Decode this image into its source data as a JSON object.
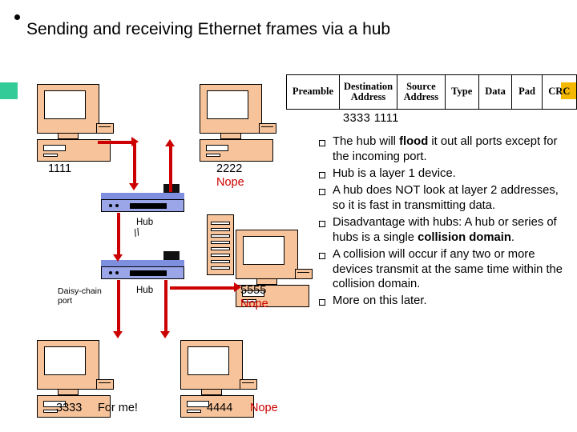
{
  "slide": {
    "title": "Sending and receiving Ethernet frames via a hub",
    "accent_green": "#33cc99",
    "accent_yellow": "#f5b800",
    "arrow_color": "#cc0000"
  },
  "frame_table": {
    "headers": [
      "Preamble",
      "Destination Address",
      "Source Address",
      "Type",
      "Data",
      "Pad",
      "CRC"
    ],
    "caption": "3333   1111"
  },
  "bullets": [
    {
      "parts": [
        {
          "text": "The hub will ",
          "bold": false
        },
        {
          "text": "flood",
          "bold": true
        },
        {
          "text": " it out all ports except for the incoming port.",
          "bold": false
        }
      ]
    },
    {
      "parts": [
        {
          "text": "Hub is a layer 1 device.",
          "bold": false
        }
      ]
    },
    {
      "parts": [
        {
          "text": "A hub does NOT look at layer 2 addresses, so it is fast in transmitting data.",
          "bold": false
        }
      ]
    },
    {
      "parts": [
        {
          "text": "Disadvantage with hubs:  A hub or series of hubs is a single ",
          "bold": false
        },
        {
          "text": "collision domain",
          "bold": true
        },
        {
          "text": ".",
          "bold": false
        }
      ]
    },
    {
      "parts": [
        {
          "text": "A collision will occur if any two or more devices transmit at the same time within the collision domain.",
          "bold": false
        }
      ]
    },
    {
      "parts": [
        {
          "text": "More on this later.",
          "bold": false
        }
      ]
    }
  ],
  "diagram": {
    "labels": {
      "pc1": "1111",
      "pc2": "2222",
      "pc2_status": "Nope",
      "pc3": "5555",
      "pc3_status": "Nope",
      "pc4": "3333",
      "pc4_status": "For me!",
      "pc5": "4444",
      "pc5_status": "Nope",
      "hub_top": "Hub",
      "hub_bottom": "Hub",
      "daisy_chain": "Daisy-chain port"
    }
  }
}
